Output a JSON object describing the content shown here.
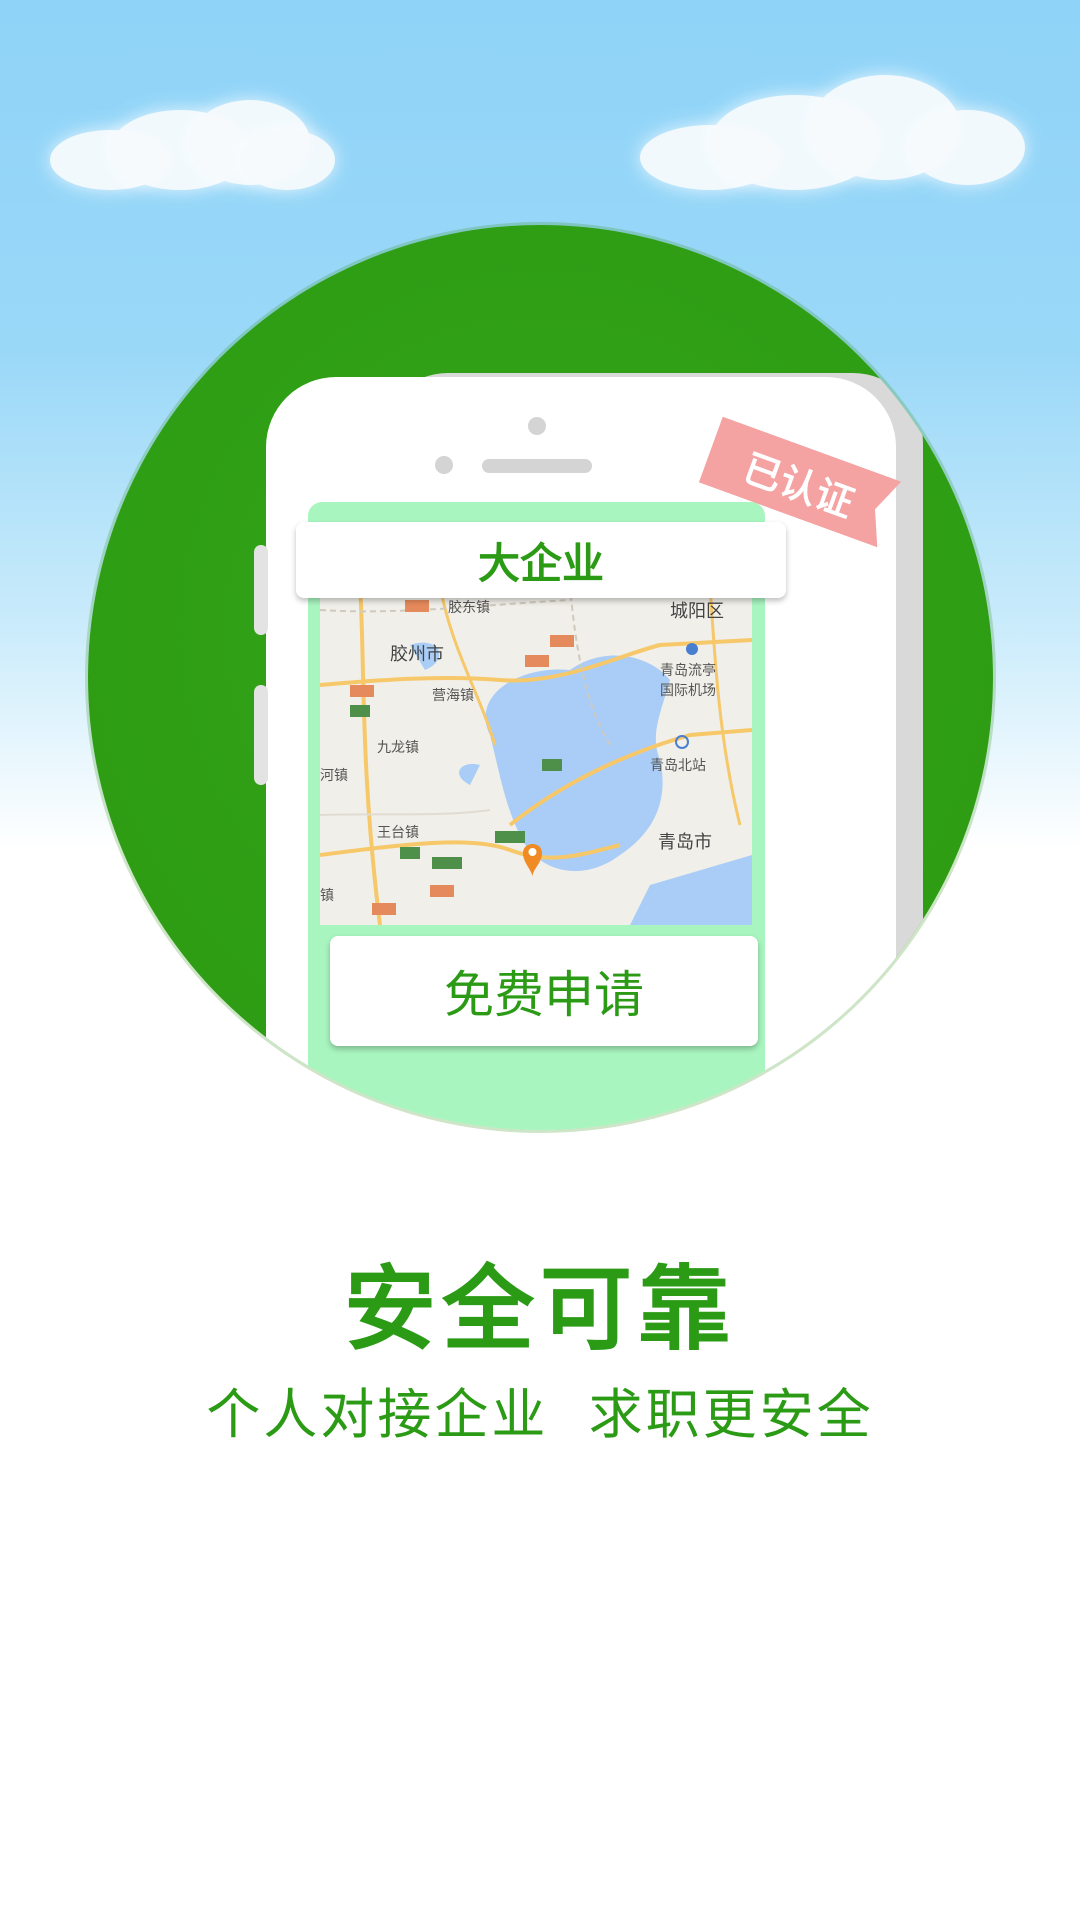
{
  "card": {
    "title": "大企业",
    "apply_button": "免费申请"
  },
  "badge": {
    "label": "已认证"
  },
  "map": {
    "labels": [
      "胶东镇",
      "城阳区",
      "胶州市",
      "青岛流亭",
      "国际机场",
      "营海镇",
      "九龙镇",
      "青岛北站",
      "王台镇",
      "青岛市",
      "河镇",
      "镇"
    ],
    "pin_icon": "location-pin-icon"
  },
  "slogan": {
    "headline": "安全可靠",
    "subline": "个人对接企业  求职更安全"
  },
  "colors": {
    "brand_green": "#2b9b16",
    "circle_green": "#2e9d14",
    "screen_mint": "#a8f5bf",
    "ribbon_pink": "#f4a2a2",
    "pin_orange": "#f08a24"
  }
}
